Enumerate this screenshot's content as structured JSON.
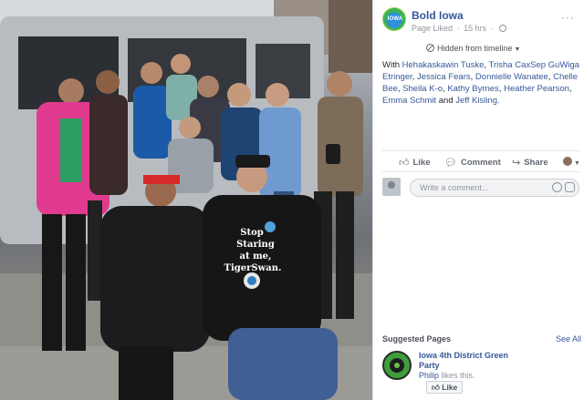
{
  "post": {
    "page_name": "Bold Iowa",
    "avatar_text": "IOWA",
    "status": "Page Liked",
    "time": "15 hrs",
    "hidden_label": "Hidden from timeline",
    "tag_intro": "With",
    "tagged_people": [
      "Hehakaskawin Tuske",
      "Trisha CaxSep GuWiga Etringer",
      "Jessica Fears",
      "Donnielle Wanatee",
      "Chelle Bee",
      "Sheila K-o",
      "Kathy Byrnes",
      "Heather Pearson",
      "Emma Schmit"
    ],
    "tag_and": "and",
    "last_tagged": "Jeff Kisling."
  },
  "actions": {
    "like": "Like",
    "comment": "Comment",
    "share": "Share"
  },
  "comment_box": {
    "placeholder": "Write a comment..."
  },
  "photo": {
    "shirt_text_lines": [
      "Stop",
      "Staring",
      "at me,",
      "TigerSwan."
    ]
  },
  "suggested": {
    "title": "Suggested Pages",
    "see_all": "See All",
    "page_name": "Iowa 4th District Green Party",
    "liker": "Philip",
    "likes_suffix": "likes this.",
    "like_button": "Like"
  }
}
